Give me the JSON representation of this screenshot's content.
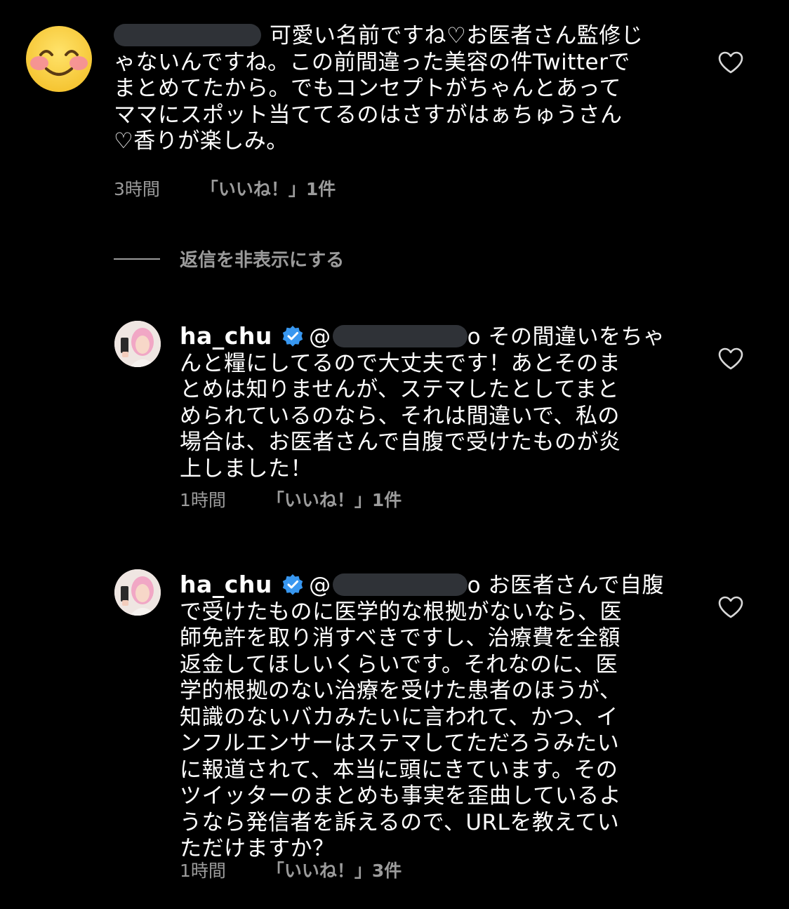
{
  "comments": [
    {
      "text_after_name": "可愛い名前ですね♡お医者さん監修じ\nゃないんですね。この前間違った美容の件Twitterで\nまとめてたから。でもコンセプトがちゃんとあって\nママにスポット当ててるのはさすがはぁちゅうさん\n♡香りが楽しみ。",
      "time": "3時間",
      "likes": "「いいね！」1件",
      "avatar_icon": "smiling-face-emoji"
    }
  ],
  "hide_replies_label": "返信を非表示にする",
  "replies": [
    {
      "username": "ha_chu",
      "mention_prefix": "@",
      "mention_suffix": "o",
      "text_first": "その間違いをちゃ",
      "text_rest": "んと糧にしてるので大丈夫です！あとそのま\nとめは知りませんが、ステマしたとしてまと\nめられているのなら、それは間違いで、私の\n場合は、お医者さんで自腹で受けたものが炎\n上しました！",
      "time": "1時間",
      "likes": "「いいね！」1件"
    },
    {
      "username": "ha_chu",
      "mention_prefix": "@",
      "mention_suffix": "o",
      "text_first": "お医者さんで自腹",
      "text_rest": "で受けたものに医学的な根拠がないなら、医\n師免許を取り消すべきですし、治療費を全額\n返金してほしいくらいです。それなのに、医\n学的根拠のない治療を受けた患者のほうが、\n知識のないバカみたいに言われて、かつ、イ\nンフルエンサーはステマしてただろうみたい\nに報道されて、本当に頭にきています。その\nツイッターのまとめも事実を歪曲しているよ\nうなら発信者を訴えるので、URLを教えてい\nただけますか？",
      "time": "1時間",
      "likes": "「いいね！」3件"
    }
  ],
  "colors": {
    "background": "#000000",
    "text": "#ffffff",
    "meta": "#9b9b9b",
    "verified": "#3897f0",
    "redaction": "#2f3237"
  }
}
